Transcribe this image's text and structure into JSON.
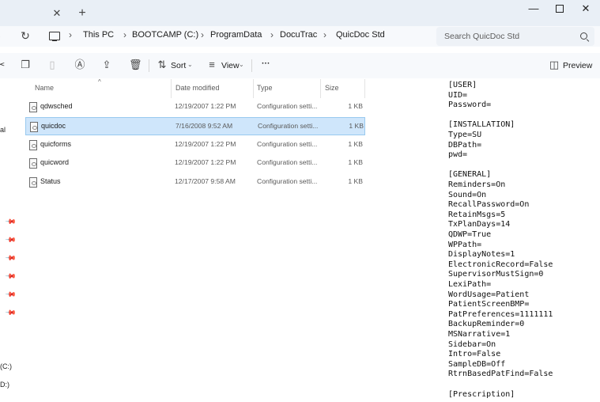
{
  "window": {
    "tab_close": "✕",
    "tab_new": "+",
    "minimize": "—",
    "close": "✕"
  },
  "address": {
    "crumbs": [
      "This PC",
      "BOOTCAMP (C:)",
      "ProgramData",
      "DocuTrac",
      "QuicDoc Std"
    ],
    "search_placeholder": "Search QuicDoc Std"
  },
  "toolbar": {
    "sort_label": "Sort",
    "view_label": "View",
    "more_label": "···",
    "preview_label": "Preview"
  },
  "nav": {
    "partial_item": "al",
    "drive_c": "(C:)",
    "drive_d": "D:)"
  },
  "columns": {
    "name": "Name",
    "date": "Date modified",
    "type": "Type",
    "size": "Size"
  },
  "files": [
    {
      "name": "qdwsched",
      "date": "12/19/2007 1:22 PM",
      "type": "Configuration setti...",
      "size": "1 KB"
    },
    {
      "name": "quicdoc",
      "date": "7/16/2008 9:52 AM",
      "type": "Configuration setti...",
      "size": "1 KB"
    },
    {
      "name": "quicforms",
      "date": "12/19/2007 1:22 PM",
      "type": "Configuration setti...",
      "size": "1 KB"
    },
    {
      "name": "quicword",
      "date": "12/19/2007 1:22 PM",
      "type": "Configuration setti...",
      "size": "1 KB"
    },
    {
      "name": "Status",
      "date": "12/17/2007 9:58 AM",
      "type": "Configuration setti...",
      "size": "1 KB"
    }
  ],
  "preview_lines": [
    "[USER]",
    "UID=",
    "Password=",
    "",
    "[INSTALLATION]",
    "Type=SU",
    "DBPath=",
    "pwd=",
    "",
    "[GENERAL]",
    "Reminders=On",
    "Sound=On",
    "RecallPassword=On",
    "RetainMsgs=5",
    "TxPlanDays=14",
    "QDWP=True",
    "WPPath=",
    "DisplayNotes=1",
    "ElectronicRecord=False",
    "SupervisorMustSign=0",
    "LexiPath=",
    "WordUsage=Patient",
    "PatientScreenBMP=",
    "PatPreferences=1111111",
    "BackupReminder=0",
    "MSNarrative=1",
    "Sidebar=On",
    "Intro=False",
    "SampleDB=Off",
    "RtrnBasedPatFind=False",
    "",
    "[Prescription]"
  ]
}
